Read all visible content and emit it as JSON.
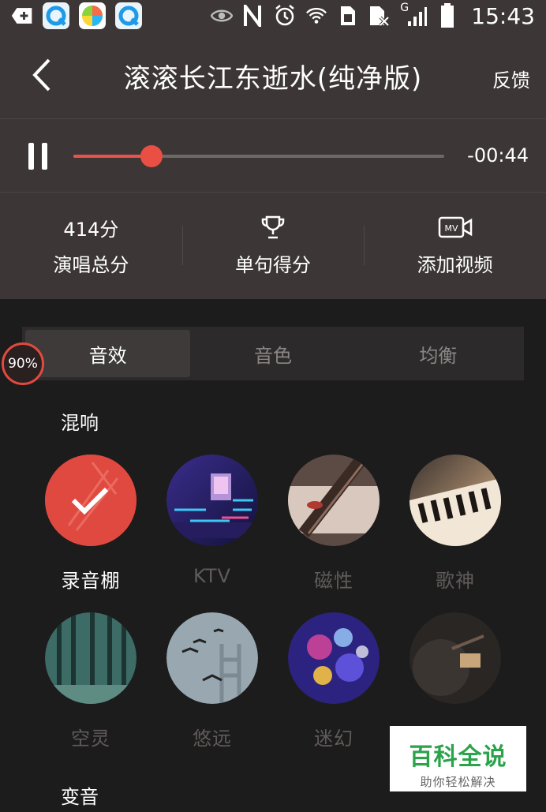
{
  "status_bar": {
    "time": "15:43",
    "icons": [
      "add-screen-icon",
      "browser-q-icon",
      "game-center-icon",
      "browser-q-icon",
      "eye-icon",
      "nfc-icon",
      "alarm-icon",
      "wifi-icon",
      "sim-icon",
      "sim-x-icon",
      "signal-icon",
      "battery-icon"
    ],
    "network_label": "G"
  },
  "header": {
    "title": "滚滚长江东逝水(纯净版)",
    "feedback": "反馈"
  },
  "player": {
    "remaining": "-00:44",
    "progress_fraction": 0.21
  },
  "stats": [
    {
      "value": "414分",
      "label": "演唱总分"
    },
    {
      "icon": "trophy-icon",
      "label": "单句得分"
    },
    {
      "icon": "mv-camera-icon",
      "label": "添加视频"
    }
  ],
  "tabs": [
    {
      "label": "音效",
      "active": true
    },
    {
      "label": "音色",
      "active": false
    },
    {
      "label": "均衡",
      "active": false
    }
  ],
  "badge": "90%",
  "sections": {
    "reverb": "混响",
    "voice_change": "变音"
  },
  "effects": [
    {
      "name": "录音棚",
      "selected": true
    },
    {
      "name": "KTV",
      "selected": false
    },
    {
      "name": "磁性",
      "selected": false
    },
    {
      "name": "歌神",
      "selected": false
    },
    {
      "name": "空灵",
      "selected": false
    },
    {
      "name": "悠远",
      "selected": false
    },
    {
      "name": "迷幻",
      "selected": false
    },
    {
      "name": "",
      "selected": false
    }
  ],
  "watermark": {
    "main": "百科全说",
    "sub": "助你轻松解决"
  },
  "colors": {
    "accent": "#ea4f43",
    "header_bg": "#3c3736",
    "body_bg": "#1d1c1c"
  }
}
